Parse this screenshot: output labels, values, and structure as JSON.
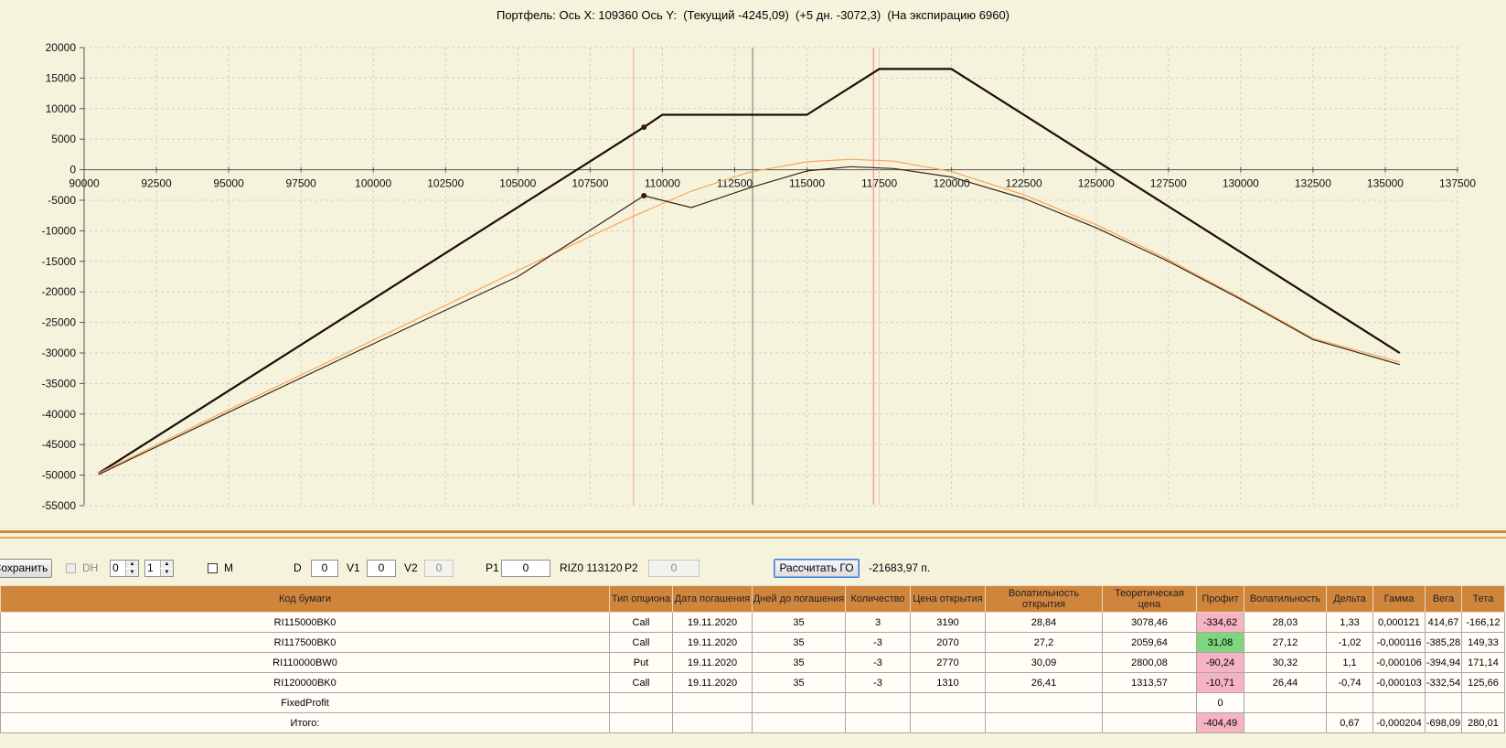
{
  "chart": {
    "title": "Портфель: Ось X: 109360 Ось Y:  (Текущий -4245,09)  (+5 дн. -3072,3)  (На экспирацию 6960)"
  },
  "chart_data": {
    "type": "line",
    "title": "Портфель: Ось X: 109360 Ось Y:  (Текущий -4245,09)  (+5 дн. -3072,3)  (На экспирацию 6960)",
    "xlim": [
      90000,
      137500
    ],
    "ylim": [
      -55000,
      20000
    ],
    "x_ticks": [
      "90000",
      "92500",
      "95000",
      "97500",
      "100000",
      "102500",
      "105000",
      "107500",
      "110000",
      "112500",
      "115000",
      "117500",
      "120000",
      "122500",
      "125000",
      "127500",
      "130000",
      "132500",
      "135000",
      "137500"
    ],
    "y_ticks": [
      "20000",
      "15000",
      "10000",
      "5000",
      "0",
      "-5000",
      "-10000",
      "-15000",
      "-20000",
      "-25000",
      "-30000",
      "-35000",
      "-40000",
      "-45000",
      "-50000",
      "-55000"
    ],
    "grid": true,
    "vertical_markers": [
      {
        "x": 109000,
        "color": "#ff9b9b"
      },
      {
        "x": 113120,
        "color": "#707070"
      },
      {
        "x": 117300,
        "color": "#ff7777"
      },
      {
        "x": 117500,
        "color": "#ffc0c0"
      }
    ],
    "series": [
      {
        "color": "#1c0d06",
        "x": [
          90500,
          109360,
          110000,
          115000,
          117500,
          120000,
          135500
        ],
        "y": [
          -49700,
          6960,
          9000,
          9000,
          16500,
          16500,
          -30000
        ]
      },
      {
        "color": "#f5a65c",
        "x": [
          90500,
          95000,
          100000,
          105000,
          109000,
          111000,
          113000,
          115000,
          116500,
          118000,
          120000,
          122500,
          125000,
          127500,
          130000,
          132500,
          135500
        ],
        "y": [
          -49700,
          -39300,
          -27900,
          -16500,
          -7600,
          -3500,
          -400,
          1300,
          1700,
          1400,
          -300,
          -4100,
          -9000,
          -14700,
          -21000,
          -27600,
          -31500
        ]
      },
      {
        "color": "#3a2414",
        "x": [
          90500,
          95000,
          100000,
          105000,
          109360,
          111000,
          113000,
          115000,
          116500,
          118000,
          120000,
          122500,
          125000,
          127500,
          130000,
          132500,
          135500
        ],
        "y": [
          -49900,
          -39700,
          -28500,
          -17500,
          -4245,
          -6200,
          -3000,
          -200,
          500,
          200,
          -1200,
          -4700,
          -9500,
          -15000,
          -21200,
          -27800,
          -31900
        ]
      }
    ],
    "markers": [
      {
        "x": 109360,
        "y": 6960
      },
      {
        "x": 109360,
        "y": -4245
      }
    ]
  },
  "toolbar": {
    "save_label": "Сохранить",
    "dh_label": "DH",
    "spin1_value": "0",
    "spin2_value": "1",
    "m_label": "M",
    "d_label": "D",
    "d_value": "0",
    "v1_label": "V1",
    "v1_value": "0",
    "v2_label": "V2",
    "v2_value": "0",
    "p1_label": "P1",
    "p1_value": "0",
    "futures_text": "RIZ0 113120",
    "p2_label": "P2",
    "p2_value": "0",
    "calc_label": "Рассчитать ГО",
    "go_value": "-21683,97 п."
  },
  "table": {
    "headers": [
      "Код бумаги",
      "Тип опциона",
      "Дата погашения",
      "Дней до погашения",
      "Количество",
      "Цена открытия",
      "Волатильность открытия",
      "Теоретическая цена",
      "Профит",
      "Волатильность",
      "Дельта",
      "Гамма",
      "Вега",
      "Тета"
    ],
    "rows": [
      [
        "RI115000BK0",
        "Call",
        "19.11.2020",
        "35",
        "3",
        "3190",
        "28,84",
        "3078,46",
        "-334,62",
        "28,03",
        "1,33",
        "0,000121",
        "414,67",
        "-166,12"
      ],
      [
        "RI117500BK0",
        "Call",
        "19.11.2020",
        "35",
        "-3",
        "2070",
        "27,2",
        "2059,64",
        "31,08",
        "27,12",
        "-1,02",
        "-0,000116",
        "-385,28",
        "149,33"
      ],
      [
        "RI110000BW0",
        "Put",
        "19.11.2020",
        "35",
        "-3",
        "2770",
        "30,09",
        "2800,08",
        "-90,24",
        "30,32",
        "1,1",
        "-0,000106",
        "-394,94",
        "171,14"
      ],
      [
        "RI120000BK0",
        "Call",
        "19.11.2020",
        "35",
        "-3",
        "1310",
        "26,41",
        "1313,57",
        "-10,71",
        "26,44",
        "-0,74",
        "-0,000103",
        "-332,54",
        "125,66"
      ],
      [
        "FixedProfit",
        "",
        "",
        "",
        "",
        "",
        "",
        "",
        "0",
        "",
        "",
        "",
        "",
        ""
      ],
      [
        "Итого:",
        "",
        "",
        "",
        "",
        "",
        "",
        "",
        "-404,49",
        "",
        "0,67",
        "-0,000204",
        "-698,09",
        "280,01"
      ]
    ],
    "profit_colors": {
      "negative": "#f6b3c3",
      "positive": "#7ed67e"
    }
  }
}
